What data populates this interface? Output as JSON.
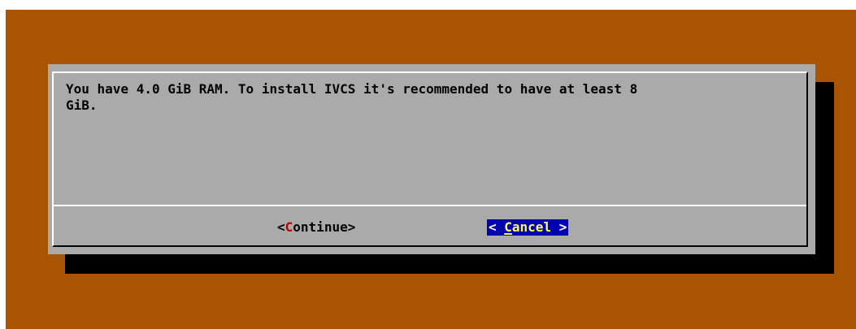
{
  "dialog": {
    "message_line1": "You have 4.0 GiB RAM. To install IVCS it's recommended to have at least 8",
    "message_line2": "GiB."
  },
  "buttons": {
    "continue": {
      "open": "<",
      "hotkey": "C",
      "rest": "ontinue",
      "close": ">"
    },
    "cancel": {
      "open": "< ",
      "hotkey": "C",
      "rest": "ancel",
      "close": " >",
      "focused": true
    }
  },
  "colors": {
    "background": "#a85400",
    "dialog": "#aaaaaa",
    "shadow": "#000000",
    "hotkey": "#b30000",
    "focus_bg": "#0000b0",
    "focus_fg": "#ffff55"
  }
}
